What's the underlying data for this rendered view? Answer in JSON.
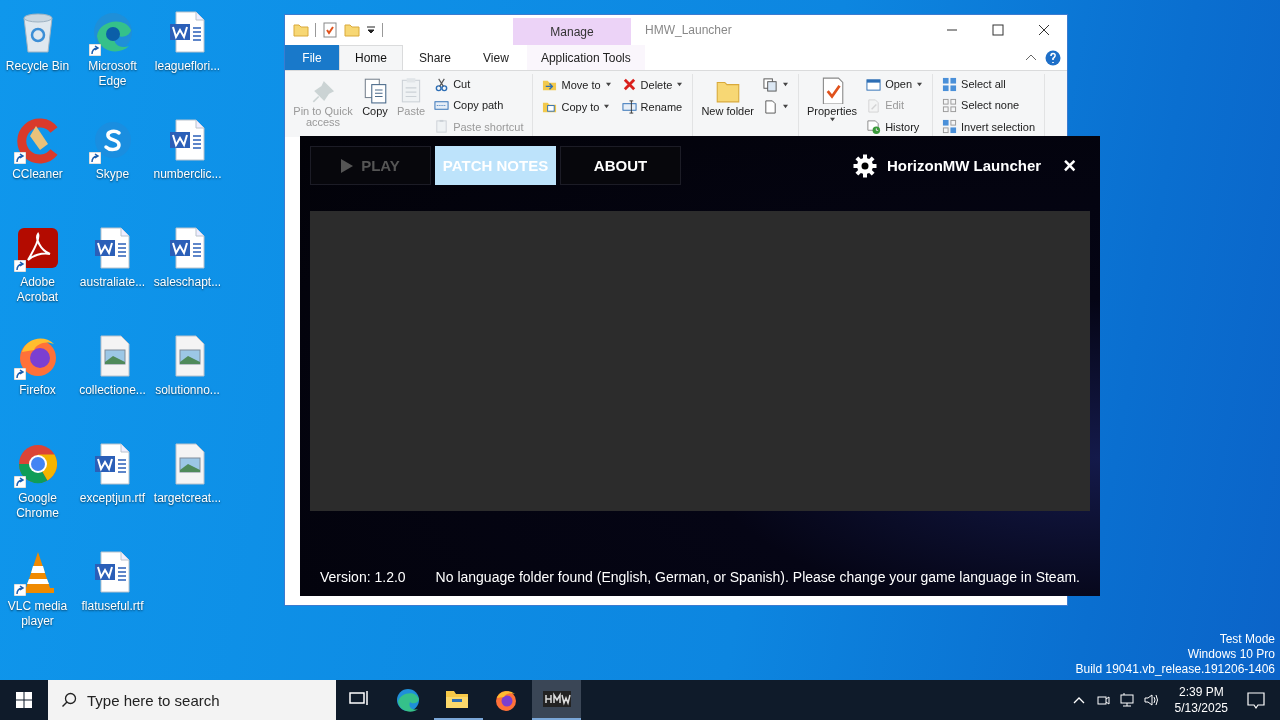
{
  "desktop": {
    "icons": [
      {
        "kind": "recycle",
        "label": "Recycle Bin",
        "shortcut": false
      },
      {
        "kind": "edge",
        "label": "Microsoft Edge",
        "shortcut": true
      },
      {
        "kind": "word",
        "label": "leagueflori...",
        "shortcut": false
      },
      {
        "kind": "ccleaner",
        "label": "CCleaner",
        "shortcut": true
      },
      {
        "kind": "skype",
        "label": "Skype",
        "shortcut": true
      },
      {
        "kind": "word",
        "label": "numberclic...",
        "shortcut": false
      },
      {
        "kind": "acrobat",
        "label": "Adobe Acrobat",
        "shortcut": true
      },
      {
        "kind": "word",
        "label": "australiate...",
        "shortcut": false
      },
      {
        "kind": "word",
        "label": "saleschapt...",
        "shortcut": false
      },
      {
        "kind": "firefox",
        "label": "Firefox",
        "shortcut": true
      },
      {
        "kind": "image",
        "label": "collectione...",
        "shortcut": false
      },
      {
        "kind": "image",
        "label": "solutionno...",
        "shortcut": false
      },
      {
        "kind": "chrome",
        "label": "Google Chrome",
        "shortcut": true
      },
      {
        "kind": "word",
        "label": "exceptjun.rtf",
        "shortcut": false
      },
      {
        "kind": "image",
        "label": "targetcreat...",
        "shortcut": false
      },
      {
        "kind": "vlc",
        "label": "VLC media player",
        "shortcut": true
      },
      {
        "kind": "word",
        "label": "flatuseful.rtf",
        "shortcut": false
      }
    ],
    "system_notice": [
      "Test Mode",
      "Windows 10 Pro",
      "Build 19041.vb_release.191206-1406"
    ]
  },
  "explorer": {
    "title": "HMW_Launcher",
    "context_tab_group": "Manage",
    "tabs": [
      {
        "kind": "file",
        "label": "File",
        "selected": false
      },
      {
        "kind": "tab",
        "label": "Home",
        "selected": true
      },
      {
        "kind": "tab",
        "label": "Share",
        "selected": false
      },
      {
        "kind": "tab",
        "label": "View",
        "selected": false
      },
      {
        "kind": "contextual",
        "label": "Application Tools",
        "selected": false
      }
    ],
    "ribbon": [
      {
        "columns": [
          {
            "kind": "large",
            "buttons": [
              {
                "kind": "pin",
                "label": "Pin to Quick access",
                "disabled": true,
                "dropdown": false
              }
            ]
          },
          {
            "kind": "large",
            "buttons": [
              {
                "kind": "copy",
                "label": "Copy",
                "disabled": false,
                "dropdown": false
              }
            ]
          },
          {
            "kind": "large",
            "buttons": [
              {
                "kind": "paste",
                "label": "Paste",
                "disabled": true,
                "dropdown": false
              }
            ]
          },
          {
            "kind": "small",
            "buttons": [
              {
                "kind": "cut",
                "label": "Cut",
                "disabled": false,
                "dropdown": false
              },
              {
                "kind": "copypath",
                "label": "Copy path",
                "disabled": false,
                "dropdown": false
              },
              {
                "kind": "pasteshortcut",
                "label": "Paste shortcut",
                "disabled": true,
                "dropdown": false
              }
            ]
          }
        ]
      },
      {
        "columns": [
          {
            "kind": "small",
            "buttons": [
              {
                "kind": "move",
                "label": "Move to",
                "disabled": false,
                "dropdown": true
              },
              {
                "kind": "copyto",
                "label": "Copy to",
                "disabled": false,
                "dropdown": true
              }
            ]
          },
          {
            "kind": "small",
            "buttons": [
              {
                "kind": "delete",
                "label": "Delete",
                "disabled": false,
                "dropdown": true
              },
              {
                "kind": "rename",
                "label": "Rename",
                "disabled": false,
                "dropdown": false
              }
            ]
          }
        ]
      },
      {
        "columns": [
          {
            "kind": "large",
            "buttons": [
              {
                "kind": "newfolder",
                "label": "New folder",
                "disabled": false,
                "dropdown": false
              }
            ]
          },
          {
            "kind": "small",
            "buttons": [
              {
                "kind": "newitem",
                "disabled": false,
                "dropdown": true
              },
              {
                "kind": "easyaccess",
                "disabled": false,
                "dropdown": true
              }
            ]
          }
        ]
      },
      {
        "columns": [
          {
            "kind": "large",
            "buttons": [
              {
                "kind": "properties",
                "label": "Properties",
                "disabled": false,
                "dropdown": true
              }
            ]
          },
          {
            "kind": "small",
            "buttons": [
              {
                "kind": "open",
                "label": "Open",
                "disabled": false,
                "dropdown": true
              },
              {
                "kind": "edit",
                "label": "Edit",
                "disabled": true,
                "dropdown": false
              },
              {
                "kind": "history",
                "label": "History",
                "disabled": false,
                "dropdown": false
              }
            ]
          }
        ]
      },
      {
        "columns": [
          {
            "kind": "small",
            "buttons": [
              {
                "kind": "selectall",
                "label": "Select all",
                "disabled": false,
                "dropdown": false
              },
              {
                "kind": "selectnone",
                "label": "Select none",
                "disabled": false,
                "dropdown": false
              },
              {
                "kind": "invert",
                "label": "Invert selection",
                "disabled": false,
                "dropdown": false
              }
            ]
          }
        ]
      }
    ]
  },
  "launcher": {
    "tabs": [
      {
        "kind": "play",
        "label": "PLAY",
        "selected": false,
        "disabled": true
      },
      {
        "kind": "text",
        "label": "PATCH NOTES",
        "selected": true,
        "disabled": false
      },
      {
        "kind": "text",
        "label": "ABOUT",
        "selected": false,
        "disabled": false
      }
    ],
    "title": "HorizonMW Launcher",
    "close": "×",
    "version": "Version: 1.2.0",
    "message": "No language folder found (English, German, or Spanish). Please change your game language in Steam."
  },
  "taskbar": {
    "search": {
      "placeholder": "Type here to search"
    },
    "apps": [
      {
        "kind": "taskview",
        "selected": false,
        "running": false
      },
      {
        "kind": "edge",
        "selected": false,
        "running": false
      },
      {
        "kind": "explorer",
        "selected": false,
        "running": true
      },
      {
        "kind": "firefox",
        "selected": false,
        "running": false
      },
      {
        "kind": "hmw",
        "selected": true,
        "running": true
      }
    ],
    "tray": [
      {
        "kind": "chevron"
      },
      {
        "kind": "camera"
      },
      {
        "kind": "network"
      },
      {
        "kind": "volume"
      }
    ],
    "time": "2:39 PM",
    "date": "5/13/2025"
  }
}
